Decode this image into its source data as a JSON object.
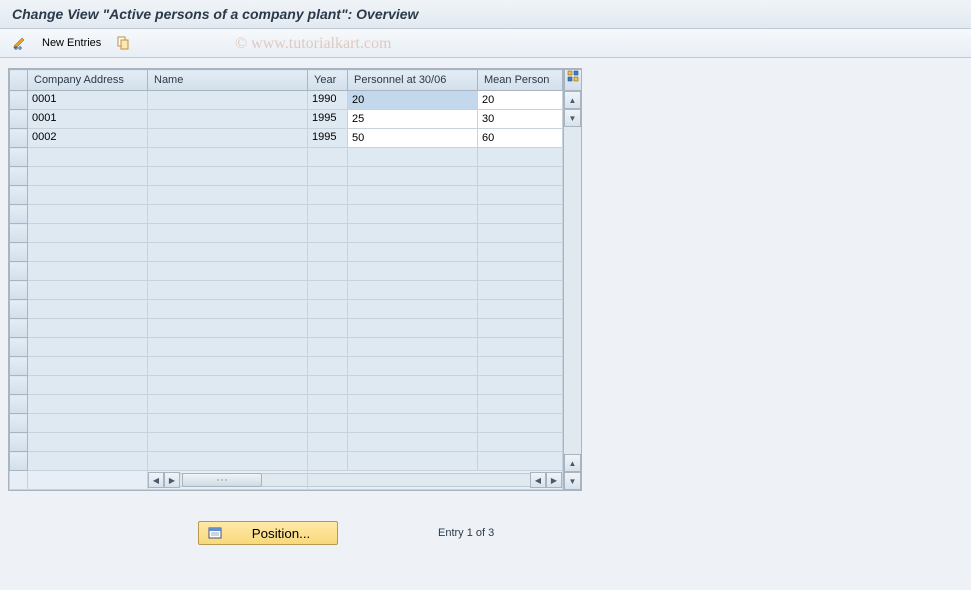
{
  "title": "Change View \"Active persons of a company plant\": Overview",
  "toolbar": {
    "new_entries": "New Entries"
  },
  "watermark": "© www.tutorialkart.com",
  "table": {
    "headers": {
      "company_address": "Company Address",
      "name": "Name",
      "year": "Year",
      "personnel_3006": "Personnel at 30/06",
      "mean_personnel": "Mean Person"
    },
    "rows": [
      {
        "company": "0001",
        "name": "",
        "year": "1990",
        "personnel": "20",
        "mean": "20"
      },
      {
        "company": "0001",
        "name": "",
        "year": "1995",
        "personnel": "25",
        "mean": "30"
      },
      {
        "company": "0002",
        "name": "",
        "year": "1995",
        "personnel": "50",
        "mean": "60"
      }
    ],
    "empty_rows": 17
  },
  "footer": {
    "position_label": "Position...",
    "entry_text": "Entry 1 of 3"
  }
}
